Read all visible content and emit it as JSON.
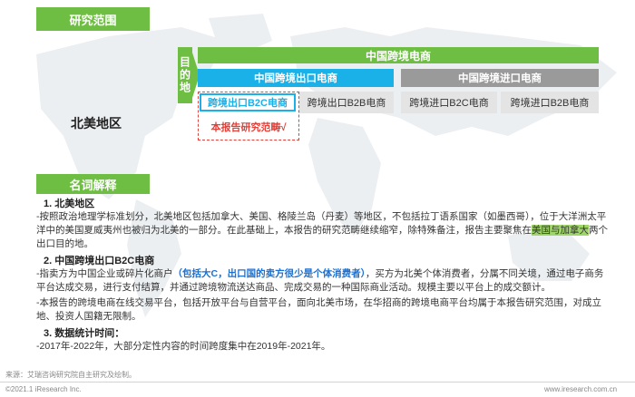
{
  "research_scope_title": "研究范围",
  "destination_label": "目的地",
  "north_america_label": "北美地区",
  "cross_border_title": "中国跨境电商",
  "export_title": "中国跨境出口电商",
  "import_title": "中国跨境进口电商",
  "export_b2c": "跨境出口B2C电商",
  "export_b2b": "跨境出口B2B电商",
  "import_b2c": "跨境进口B2C电商",
  "import_b2b": "跨境进口B2B电商",
  "scope_note": "本报告研究范畴√",
  "glossary_title": "名词解释",
  "section1": {
    "title": "1.    北美地区",
    "text_a": "-按照政治地理学标准划分，北美地区包括加拿大、美国、格陵兰岛（丹麦）等地区，不包括拉丁语系国家（如墨西哥），位于大洋洲太平洋中的美国夏威夷州也被归为北美的一部分。在此基础上，本报告的研究范畴继续缩窄，除特殊备注，报告主要聚焦在",
    "highlight": "美国与加拿大",
    "text_b": "两个出口目的地。"
  },
  "section2": {
    "title": "2.    中国跨境出口B2C电商",
    "p1_a": "-指卖方为中国企业或碎片化商户",
    "p1_blue": "（包括大C，出口国的卖方很少是个体消费者）",
    "p1_b": "，买方为北美个体消费者，分属不同关境，通过电子商务平台达成交易，进行支付结算，并通过跨境物流送达商品、完成交易的一种国际商业活动。规模主要以平台上的成交额计。",
    "p2": "-本报告的跨境电商在线交易平台，包括开放平台与自营平台，面向北美市场，在华招商的跨境电商平台均属于本报告研究范围，对成立地、投资人国籍无限制。"
  },
  "section3": {
    "title": "3.    数据统计时间：",
    "text": "-2017年-2022年，大部分定性内容的时间跨度集中在2019年-2021年。"
  },
  "source": "来源：艾瑞咨询研究院自主研究及绘制。",
  "copyright": "©2021.1 iResearch Inc.",
  "website": "www.iresearch.com.cn",
  "colors": {
    "green": "#6fbe44",
    "blue": "#1ab0e8",
    "gray": "#9a9a9a",
    "red": "#e0413a"
  }
}
